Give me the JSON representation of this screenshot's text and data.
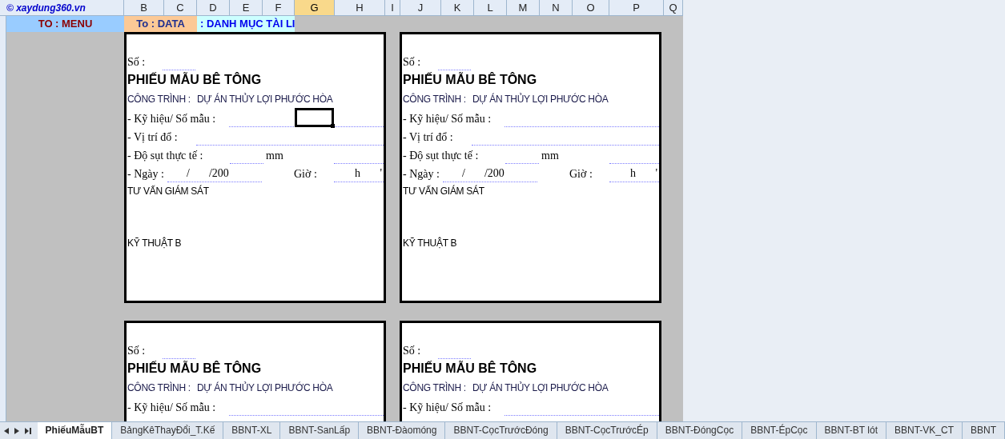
{
  "logo": "© xaydung360.vn",
  "columns": [
    {
      "label": "B",
      "selected": false
    },
    {
      "label": "C",
      "selected": false
    },
    {
      "label": "D",
      "selected": false
    },
    {
      "label": "E",
      "selected": false
    },
    {
      "label": "F",
      "selected": false
    },
    {
      "label": "G",
      "selected": true
    },
    {
      "label": "H",
      "selected": false
    },
    {
      "label": "I",
      "selected": false
    },
    {
      "label": "J",
      "selected": false
    },
    {
      "label": "K",
      "selected": false
    },
    {
      "label": "L",
      "selected": false
    },
    {
      "label": "M",
      "selected": false
    },
    {
      "label": "N",
      "selected": false
    },
    {
      "label": "O",
      "selected": false
    },
    {
      "label": "P",
      "selected": false
    },
    {
      "label": "Q",
      "selected": false
    }
  ],
  "links": [
    {
      "label": "TO : MENU",
      "kind": "menu"
    },
    {
      "label": "To : DATA",
      "kind": "data"
    },
    {
      "label": ": DANH MỤC TÀI LI",
      "kind": "catalog"
    }
  ],
  "cards": [
    {
      "number_label": "Số :",
      "title": "PHIẾU MẪU BÊ TÔNG",
      "project_label": "CÔNG TRÌNH :",
      "project": "DỰ ÁN THỦY LỢI PHƯỚC HÒA",
      "fields": [
        {
          "kind": "code",
          "label": "- Kỹ hiệu/ Số mẫu :",
          "active": true
        },
        {
          "kind": "place",
          "label": "- Vị trí đổ :",
          "active": false
        },
        {
          "kind": "slump",
          "label": "- Độ sụt thực tế :",
          "unit": "mm",
          "active": false
        },
        {
          "kind": "datetime",
          "label": "- Ngày :",
          "date_sep": "/",
          "year": "/200",
          "time_label": "Giờ :",
          "hour": "h",
          "minute": "'",
          "active": false
        }
      ],
      "signers": [
        "TƯ VẤN GIÁM SÁT",
        "KỸ THUẬT B"
      ]
    },
    {
      "number_label": "Số :",
      "title": "PHIẾU MẪU BÊ TÔNG",
      "project_label": "CÔNG TRÌNH :",
      "project": "DỰ ÁN THỦY LỢI PHƯỚC HÒA",
      "fields": [
        {
          "kind": "code",
          "label": "- Kỹ hiệu/ Số mẫu :",
          "active": false
        },
        {
          "kind": "place",
          "label": "- Vị trí đổ :",
          "active": false
        },
        {
          "kind": "slump",
          "label": "- Độ sụt thực tế :",
          "unit": "mm",
          "active": false
        },
        {
          "kind": "datetime",
          "label": "- Ngày :",
          "date_sep": "/",
          "year": "/200",
          "time_label": "Giờ :",
          "hour": "h",
          "minute": "'",
          "active": false
        }
      ],
      "signers": [
        "TƯ VẤN GIÁM SÁT",
        "KỸ THUẬT B"
      ]
    },
    {
      "number_label": "Số :",
      "title": "PHIẾU MẪU BÊ TÔNG",
      "project_label": "CÔNG TRÌNH :",
      "project": "DỰ ÁN THỦY LỢI PHƯỚC HÒA",
      "fields": [
        {
          "kind": "code",
          "label": "- Kỹ hiệu/ Số mẫu :",
          "active": false
        }
      ]
    },
    {
      "number_label": "Số :",
      "title": "PHIẾU MẪU BÊ TÔNG",
      "project_label": "CÔNG TRÌNH :",
      "project": "DỰ ÁN THỦY LỢI PHƯỚC HÒA",
      "fields": [
        {
          "kind": "code",
          "label": "- Kỹ hiệu/ Số mẫu :",
          "active": false
        }
      ]
    }
  ],
  "sheet_tabs": [
    {
      "label": "PhiếuMẫuBT",
      "selected": true
    },
    {
      "label": "BảngKêThayĐổi_T.Kế",
      "selected": false
    },
    {
      "label": "BBNT-XL",
      "selected": false
    },
    {
      "label": "BBNT-SanLấp",
      "selected": false
    },
    {
      "label": "BBNT-Đàomóng",
      "selected": false
    },
    {
      "label": "BBNT-CọcTrướcĐóng",
      "selected": false
    },
    {
      "label": "BBNT-CọcTrướcÉp",
      "selected": false
    },
    {
      "label": "BBNT-ĐóngCọc",
      "selected": false
    },
    {
      "label": "BBNT-ÉpCọc",
      "selected": false
    },
    {
      "label": "BBNT-BT lót",
      "selected": false
    },
    {
      "label": "BBNT-VK_CT",
      "selected": false
    },
    {
      "label": "BBNT",
      "selected": false
    }
  ]
}
